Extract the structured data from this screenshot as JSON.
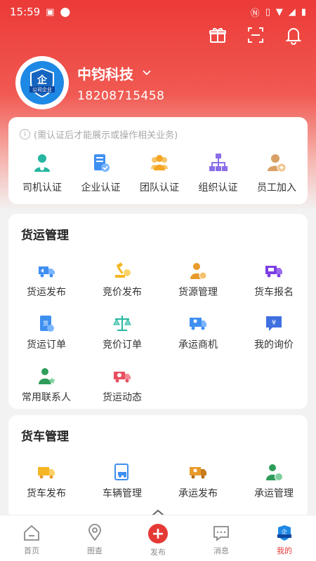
{
  "status_bar": {
    "time": "15:59"
  },
  "company": {
    "name": "中钧科技",
    "phone": "18208715458",
    "badge_text": "公司企业"
  },
  "certification": {
    "notice": "(需认证后才能展示或操作相关业务)",
    "items": [
      {
        "label": "司机认证",
        "icon": "driver-icon",
        "color": "#26b6a0"
      },
      {
        "label": "企业认证",
        "icon": "enterprise-icon",
        "color": "#3f8ff0"
      },
      {
        "label": "团队认证",
        "icon": "team-icon",
        "color": "#f5a623"
      },
      {
        "label": "组织认证",
        "icon": "org-icon",
        "color": "#8a6ee8"
      },
      {
        "label": "员工加入",
        "icon": "employee-add-icon",
        "color": "#d9a066"
      }
    ]
  },
  "freight": {
    "title": "货运管理",
    "items": [
      {
        "label": "货运发布",
        "icon": "truck-publish-icon",
        "color": "#3f8ff0"
      },
      {
        "label": "竞价发布",
        "icon": "auction-icon",
        "color": "#f5b623"
      },
      {
        "label": "货源管理",
        "icon": "cargo-manage-icon",
        "color": "#e89a2c"
      },
      {
        "label": "货车报名",
        "icon": "truck-signup-icon",
        "color": "#7b3fe4"
      },
      {
        "label": "货运订单",
        "icon": "order-icon",
        "color": "#3f8ff0"
      },
      {
        "label": "竞价订单",
        "icon": "scale-icon",
        "color": "#26b6a0"
      },
      {
        "label": "承运商机",
        "icon": "carrier-opportunity-icon",
        "color": "#3f8ff0"
      },
      {
        "label": "我的询价",
        "icon": "inquiry-icon",
        "color": "#3f6fe0"
      },
      {
        "label": "常用联系人",
        "icon": "contact-icon",
        "color": "#2e9d5a"
      },
      {
        "label": "货运动态",
        "icon": "freight-status-icon",
        "color": "#e85060"
      }
    ]
  },
  "truck": {
    "title": "货车管理",
    "items": [
      {
        "label": "货车发布",
        "icon": "truck-icon",
        "color": "#f5b623"
      },
      {
        "label": "车辆管理",
        "icon": "vehicle-manage-icon",
        "color": "#3f8ff0"
      },
      {
        "label": "承运发布",
        "icon": "carrier-publish-icon",
        "color": "#e89a2c"
      },
      {
        "label": "承运管理",
        "icon": "carrier-manage-icon",
        "color": "#2e9d5a"
      }
    ]
  },
  "tabbar": [
    {
      "label": "首页",
      "icon": "home-icon"
    },
    {
      "label": "图查",
      "icon": "map-pin-icon"
    },
    {
      "label": "发布",
      "icon": "plus-icon"
    },
    {
      "label": "消息",
      "icon": "message-icon"
    },
    {
      "label": "我的",
      "icon": "profile-badge-icon"
    }
  ],
  "colors": {
    "brand_red": "#e53935",
    "header_red": "#ec3a37"
  }
}
